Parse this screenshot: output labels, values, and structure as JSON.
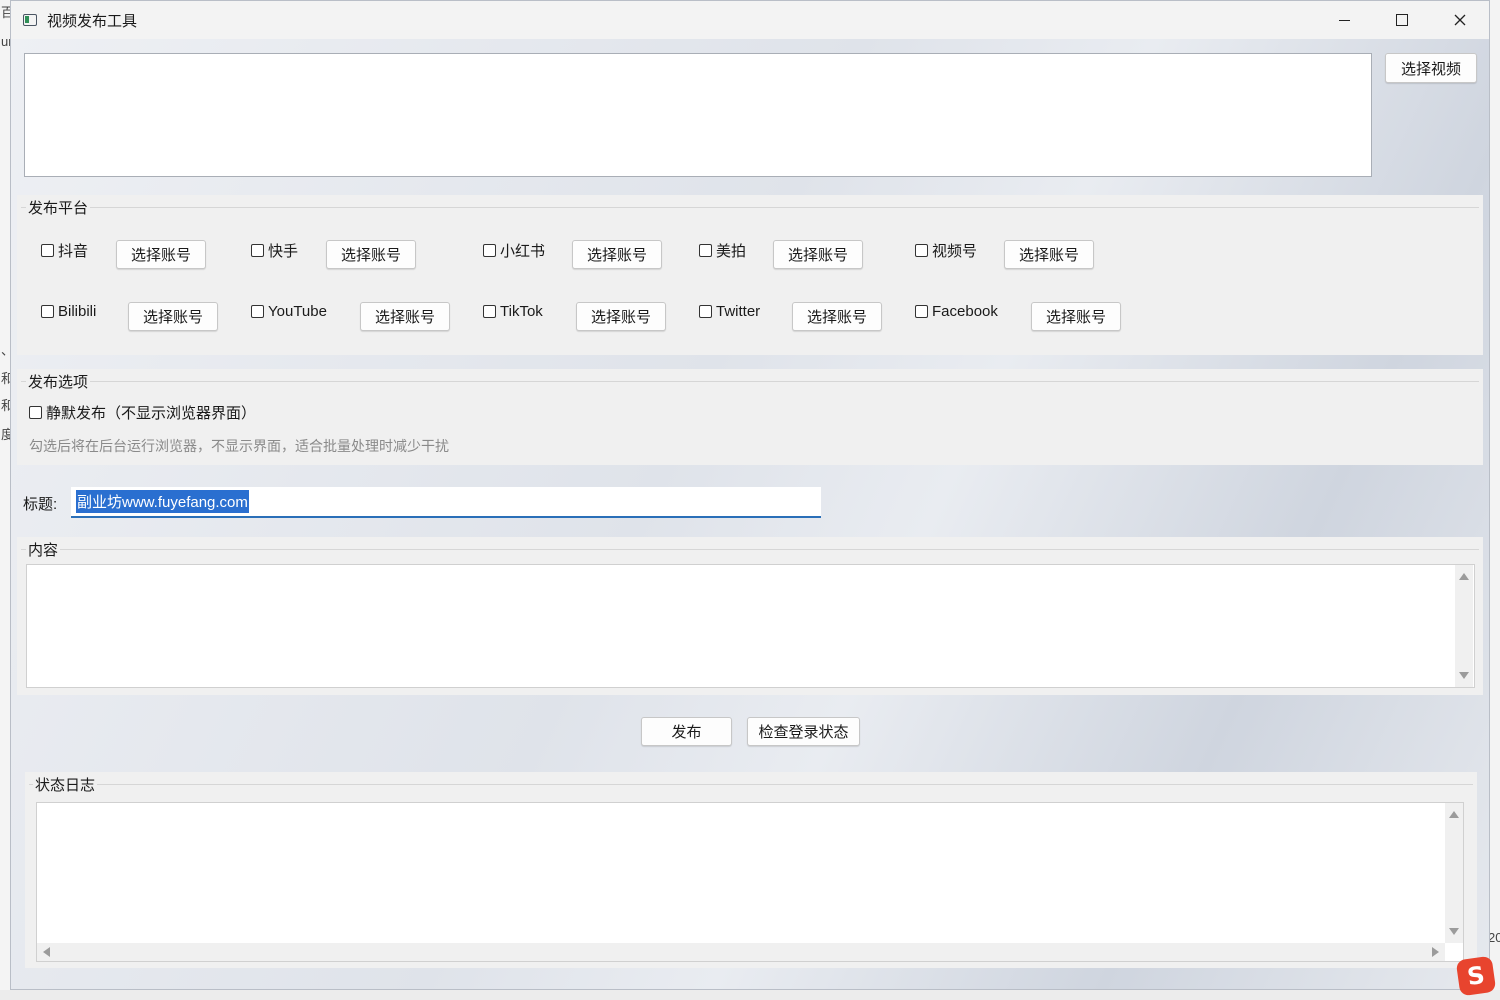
{
  "window": {
    "title": "视频发布工具"
  },
  "video": {
    "select_label": "选择视频",
    "path_text": ""
  },
  "platforms": {
    "group_title": "发布平台",
    "choose_account_label": "选择账号",
    "items": [
      {
        "name": "抖音",
        "checked": false
      },
      {
        "name": "快手",
        "checked": false
      },
      {
        "name": "小红书",
        "checked": false
      },
      {
        "name": "美拍",
        "checked": false
      },
      {
        "name": "视频号",
        "checked": false
      },
      {
        "name": "Bilibili",
        "checked": false
      },
      {
        "name": "YouTube",
        "checked": false
      },
      {
        "name": "TikTok",
        "checked": false
      },
      {
        "name": "Twitter",
        "checked": false
      },
      {
        "name": "Facebook",
        "checked": false
      }
    ]
  },
  "options": {
    "group_title": "发布选项",
    "silent_label": "静默发布（不显示浏览器界面）",
    "silent_checked": false,
    "silent_hint": "勾选后将在后台运行浏览器，不显示界面，适合批量处理时减少干扰"
  },
  "form": {
    "title_label": "标题:",
    "title_value": "副业坊www.fuyefang.com",
    "content_group": "内容",
    "content_value": ""
  },
  "actions": {
    "publish_label": "发布",
    "check_login_label": "检查登录状态"
  },
  "log": {
    "group_title": "状态日志",
    "text": ""
  },
  "desktop": {
    "left_fragments": [
      "百",
      "ur",
      "、",
      "和",
      "和",
      "度"
    ],
    "right_fragment": "20"
  },
  "tray": {
    "ime_glyph": "S"
  },
  "colors": {
    "accent": "#2a6fb8",
    "selection": "#2a6fd0",
    "panel": "#f0f0f0"
  }
}
